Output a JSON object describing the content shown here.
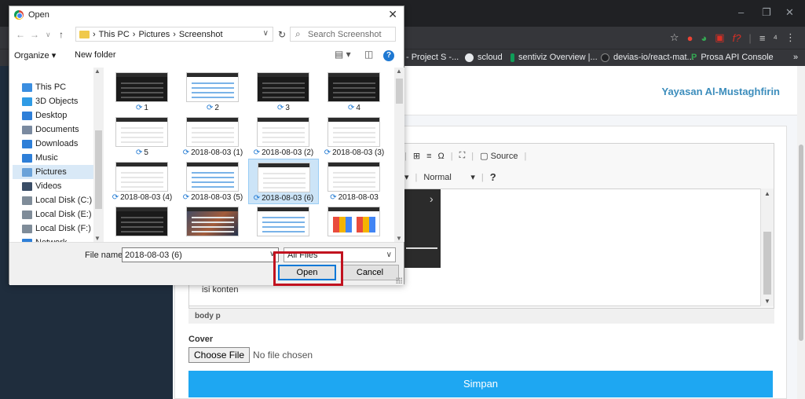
{
  "browser": {
    "bookmarks": [
      {
        "label": "- Project S -...",
        "icon_color": "#3c4043"
      },
      {
        "label": "scloud",
        "icon_color": "#e8eaed"
      },
      {
        "label": "sentiviz Overview |...",
        "icon_color": "#0f9d58"
      },
      {
        "label": "devias-io/react-mat...",
        "icon_color": "#202124"
      },
      {
        "label": "Prosa API Console",
        "icon_color": "#34a853"
      }
    ],
    "more_bookmarks": "»",
    "window_controls": [
      "–",
      "❐",
      "✕"
    ]
  },
  "webpage": {
    "brand": "Yayasan Al-Mustaghfirin",
    "editor": {
      "source_label": "Source",
      "format_label": "Normal",
      "help_mark": "?",
      "content": "isi konten",
      "path": "body  p"
    },
    "cover_label": "Cover",
    "choose_file_label": "Choose File",
    "no_file_label": "No file chosen",
    "submit_label": "Simpan",
    "accent_color": "#1ea7f2"
  },
  "dialog": {
    "title": "Open",
    "close_label": "✕",
    "path": [
      "This PC",
      "Pictures",
      "Screenshot"
    ],
    "search_placeholder": "Search Screenshot",
    "organize_label": "Organize ▾",
    "new_folder_label": "New folder",
    "nav_items": [
      {
        "label": "This PC",
        "icon": "pc-icon",
        "color": "#3b8ee0"
      },
      {
        "label": "3D Objects",
        "icon": "cube-icon",
        "color": "#2f9be5"
      },
      {
        "label": "Desktop",
        "icon": "desktop-icon",
        "color": "#2e7fd8"
      },
      {
        "label": "Documents",
        "icon": "document-icon",
        "color": "#7a8aa0"
      },
      {
        "label": "Downloads",
        "icon": "download-icon",
        "color": "#2e7fd8"
      },
      {
        "label": "Music",
        "icon": "music-icon",
        "color": "#2e7fd8"
      },
      {
        "label": "Pictures",
        "icon": "pictures-icon",
        "color": "#6aa2d9"
      },
      {
        "label": "Videos",
        "icon": "video-icon",
        "color": "#3a4d66"
      },
      {
        "label": "Local Disk (C:)",
        "icon": "disk-icon",
        "color": "#7f8c99"
      },
      {
        "label": "Local Disk (E:)",
        "icon": "disk-icon",
        "color": "#7f8c99"
      },
      {
        "label": "Local Disk (F:)",
        "icon": "disk-icon",
        "color": "#7f8c99"
      },
      {
        "label": "Network",
        "icon": "network-icon",
        "color": "#2e7fd8"
      }
    ],
    "files": [
      {
        "label": "1",
        "style": "dark"
      },
      {
        "label": "2",
        "style": "blue"
      },
      {
        "label": "3",
        "style": "dark"
      },
      {
        "label": "4",
        "style": "dark"
      },
      {
        "label": "5",
        "style": "light"
      },
      {
        "label": "2018-08-03 (1)",
        "style": "light"
      },
      {
        "label": "2018-08-03 (2)",
        "style": "light"
      },
      {
        "label": "2018-08-03 (3)",
        "style": "light"
      },
      {
        "label": "2018-08-03 (4)",
        "style": "light"
      },
      {
        "label": "2018-08-03 (5)",
        "style": "blue"
      },
      {
        "label": "2018-08-03 (6)",
        "style": "light",
        "selected": true
      },
      {
        "label": "2018-08-03",
        "style": "light"
      },
      {
        "label": "",
        "style": "dark"
      },
      {
        "label": "",
        "style": "photo"
      },
      {
        "label": "",
        "style": "blue"
      },
      {
        "label": "",
        "style": "color"
      }
    ],
    "file_name_label": "File name:",
    "file_name_value": "2018-08-03 (6)",
    "file_type_value": "All Files",
    "open_label": "Open",
    "cancel_label": "Cancel",
    "highlight_color": "#c1121f"
  }
}
